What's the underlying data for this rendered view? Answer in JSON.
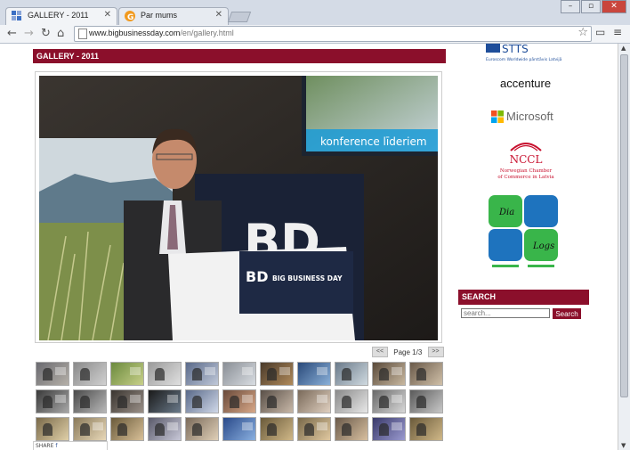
{
  "browser": {
    "tabs": [
      {
        "title": "GALLERY - 2011",
        "active": true,
        "favicon": "gallery-favicon"
      },
      {
        "title": "Par mums",
        "active": false,
        "favicon": "g-favicon"
      }
    ],
    "url_host": "www.bigbusinessday.com",
    "url_path": "/en/gallery.html"
  },
  "page": {
    "gallery_title": "GALLERY - 2011",
    "photo": {
      "screen_text": "konference līderiem",
      "podium_text": "BIG BUSINESS DAY",
      "podium_logo": "BD"
    },
    "pager": {
      "prev": "<<",
      "label": "Page 1/3",
      "next": ">>"
    },
    "share_label": "SHARE"
  },
  "sidebar": {
    "sponsors": [
      {
        "name": "STTS",
        "tagline": "Euroscom Worldwide pārstāvis Latvijā"
      },
      {
        "name": "accenture"
      },
      {
        "name": "Microsoft"
      },
      {
        "name": "NCCL",
        "tagline1": "Norwegian Chamber",
        "tagline2": "of Commerce in Latvia"
      },
      {
        "name": "Dia Logs"
      }
    ],
    "search": {
      "header": "SEARCH",
      "placeholder": "search...",
      "button": "Search"
    }
  },
  "colors": {
    "brand": "#8b0f2b",
    "chrome": "#d4dbe6"
  }
}
